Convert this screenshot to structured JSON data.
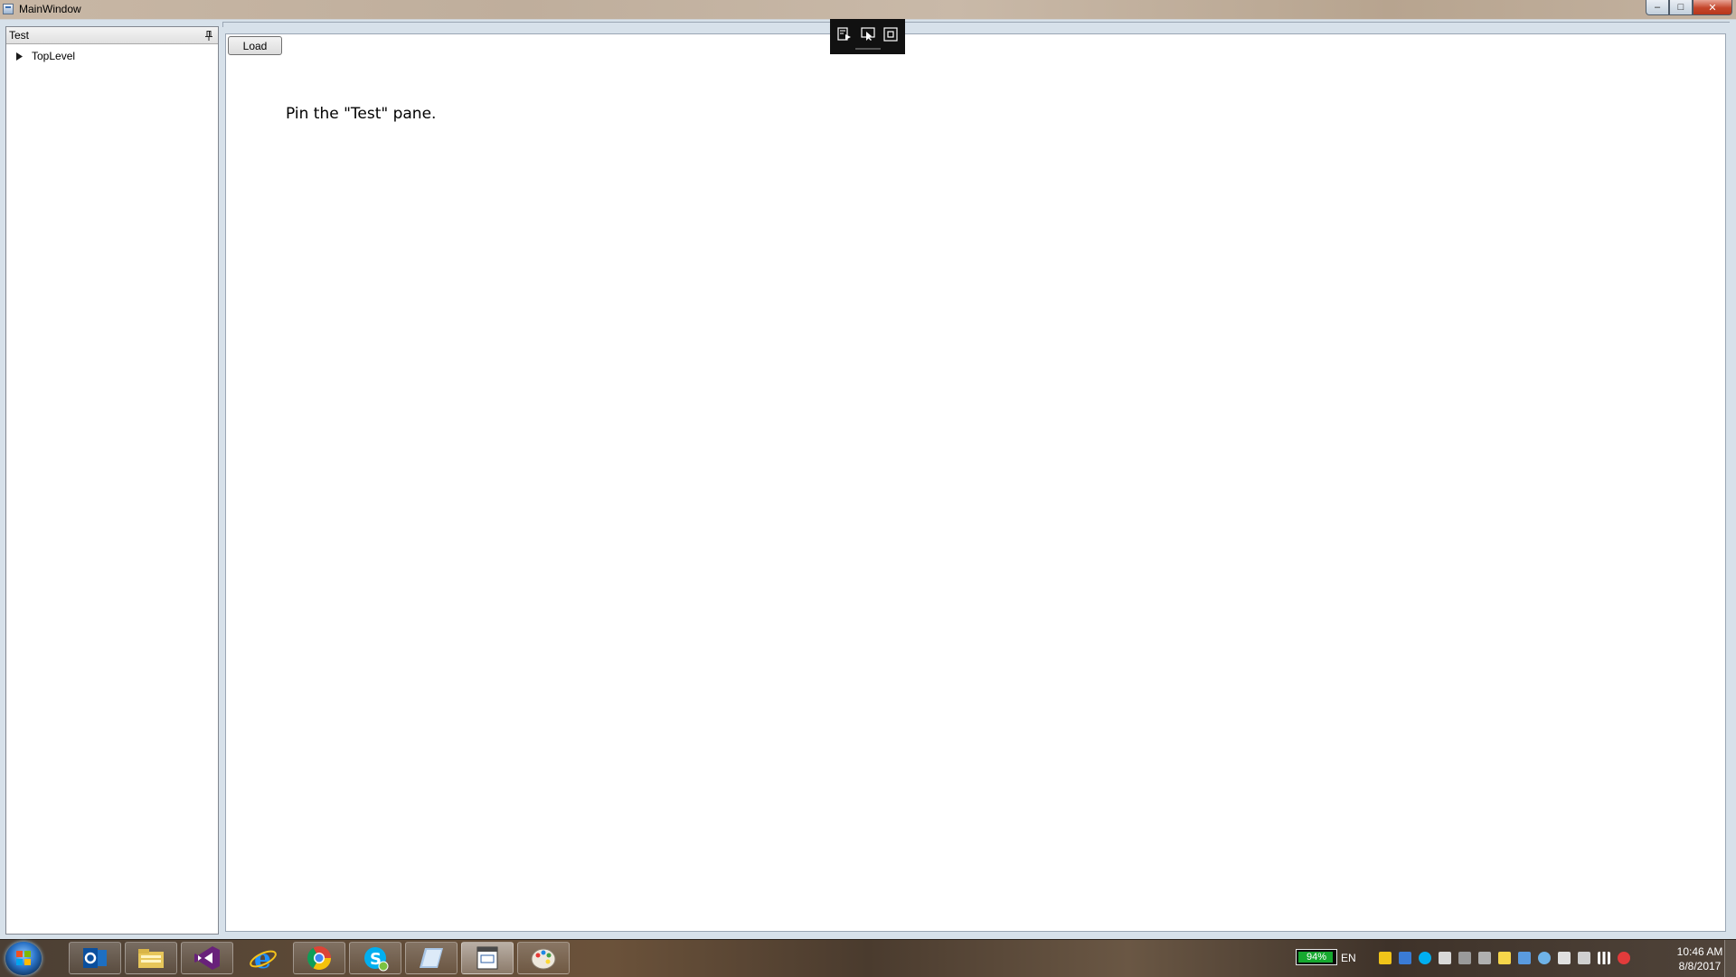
{
  "window": {
    "title": "MainWindow",
    "minimize_glyph": "–",
    "maximize_glyph": "□",
    "close_glyph": "✕"
  },
  "dock_pane": {
    "title": "Test",
    "pin_icon": "pin-icon",
    "tree": [
      {
        "label": "TopLevel",
        "expanded": false
      }
    ]
  },
  "main": {
    "load_label": "Load",
    "instruction": "Pin the \"Test\" pane."
  },
  "floating_toolbar": {
    "icons": [
      "visual-tree-icon",
      "select-element-icon",
      "layout-adorner-icon"
    ]
  },
  "taskbar": {
    "apps": [
      "outlook-icon",
      "file-explorer-icon",
      "visual-studio-icon",
      "internet-explorer-icon",
      "chrome-icon",
      "skype-icon",
      "notepad-icon",
      "calendar-app-icon",
      "paint-icon"
    ],
    "language": "EN",
    "battery": "94%",
    "battery_level": 0.94,
    "time": "10:46 AM",
    "date": "8/8/2017"
  },
  "colors": {
    "battery_fill": "#16a82f",
    "close_button": "#c4452a",
    "toolbar_bg": "#111111"
  }
}
